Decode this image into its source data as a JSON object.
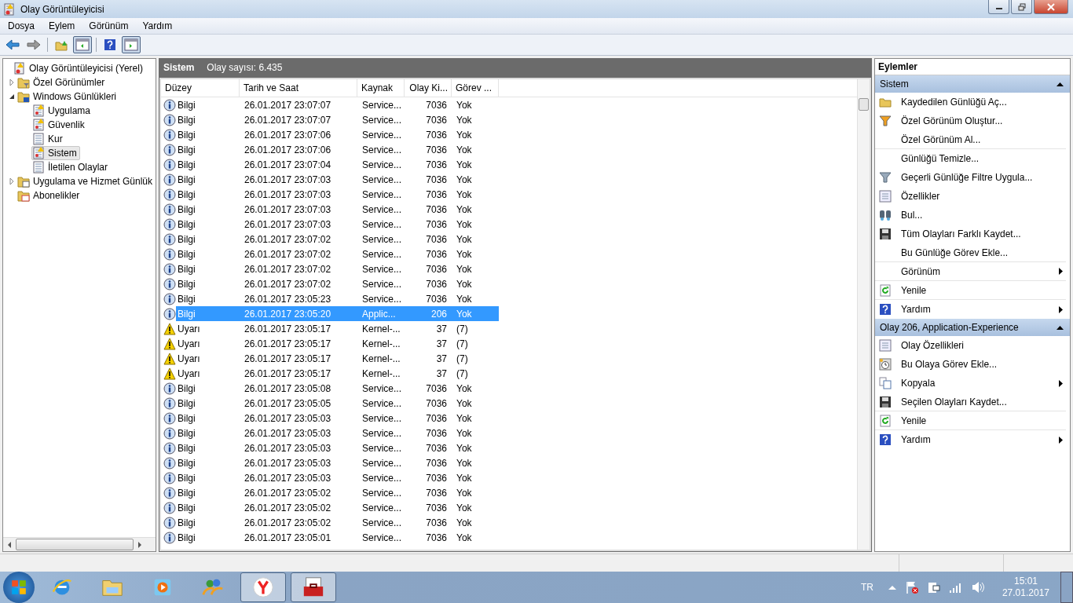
{
  "window": {
    "title": "Olay Görüntüleyicisi"
  },
  "menu": [
    "Dosya",
    "Eylem",
    "Görünüm",
    "Yardım"
  ],
  "toolbar": [
    {
      "kind": "back",
      "pressed": false
    },
    {
      "kind": "forward",
      "pressed": false
    },
    {
      "kind": "sep"
    },
    {
      "kind": "up",
      "pressed": false
    },
    {
      "kind": "tree",
      "pressed": true
    },
    {
      "kind": "sep"
    },
    {
      "kind": "help",
      "pressed": false
    },
    {
      "kind": "pane",
      "pressed": true
    }
  ],
  "tree": [
    {
      "label": "Olay Görüntüleyicisi (Yerel)",
      "kind": "root",
      "selected": false,
      "children": [
        {
          "label": "Özel Görünümler",
          "kind": "folder-filter",
          "selected": false,
          "expanded": false
        },
        {
          "label": "Windows Günlükleri",
          "kind": "folder-windows",
          "selected": false,
          "expanded": true,
          "children": [
            {
              "label": "Uygulama",
              "kind": "log-alert",
              "selected": false
            },
            {
              "label": "Güvenlik",
              "kind": "log-alert",
              "selected": false
            },
            {
              "label": "Kur",
              "kind": "log",
              "selected": false
            },
            {
              "label": "Sistem",
              "kind": "log-alert",
              "selected": true
            },
            {
              "label": "İletilen Olaylar",
              "kind": "log",
              "selected": false
            }
          ]
        },
        {
          "label": "Uygulama ve Hizmet Günlük",
          "kind": "folder-app",
          "selected": false,
          "expanded": false
        },
        {
          "label": "Abonelikler",
          "kind": "folder-subs",
          "selected": false
        }
      ]
    }
  ],
  "log": {
    "title": "Sistem",
    "count": "Olay sayısı: 6.435"
  },
  "table": {
    "columns": [
      "Düzey",
      "Tarih ve Saat",
      "Kaynak",
      "Olay Ki...",
      "Görev ..."
    ],
    "rows": [
      {
        "kind": "info",
        "level_text": "Bilgi",
        "date": "26.01.2017 23:07:07",
        "source": "Service...",
        "id": "7036",
        "task": "Yok",
        "selected": false
      },
      {
        "kind": "info",
        "level_text": "Bilgi",
        "date": "26.01.2017 23:07:07",
        "source": "Service...",
        "id": "7036",
        "task": "Yok",
        "selected": false
      },
      {
        "kind": "info",
        "level_text": "Bilgi",
        "date": "26.01.2017 23:07:06",
        "source": "Service...",
        "id": "7036",
        "task": "Yok",
        "selected": false
      },
      {
        "kind": "info",
        "level_text": "Bilgi",
        "date": "26.01.2017 23:07:06",
        "source": "Service...",
        "id": "7036",
        "task": "Yok",
        "selected": false
      },
      {
        "kind": "info",
        "level_text": "Bilgi",
        "date": "26.01.2017 23:07:04",
        "source": "Service...",
        "id": "7036",
        "task": "Yok",
        "selected": false
      },
      {
        "kind": "info",
        "level_text": "Bilgi",
        "date": "26.01.2017 23:07:03",
        "source": "Service...",
        "id": "7036",
        "task": "Yok",
        "selected": false
      },
      {
        "kind": "info",
        "level_text": "Bilgi",
        "date": "26.01.2017 23:07:03",
        "source": "Service...",
        "id": "7036",
        "task": "Yok",
        "selected": false
      },
      {
        "kind": "info",
        "level_text": "Bilgi",
        "date": "26.01.2017 23:07:03",
        "source": "Service...",
        "id": "7036",
        "task": "Yok",
        "selected": false
      },
      {
        "kind": "info",
        "level_text": "Bilgi",
        "date": "26.01.2017 23:07:03",
        "source": "Service...",
        "id": "7036",
        "task": "Yok",
        "selected": false
      },
      {
        "kind": "info",
        "level_text": "Bilgi",
        "date": "26.01.2017 23:07:02",
        "source": "Service...",
        "id": "7036",
        "task": "Yok",
        "selected": false
      },
      {
        "kind": "info",
        "level_text": "Bilgi",
        "date": "26.01.2017 23:07:02",
        "source": "Service...",
        "id": "7036",
        "task": "Yok",
        "selected": false
      },
      {
        "kind": "info",
        "level_text": "Bilgi",
        "date": "26.01.2017 23:07:02",
        "source": "Service...",
        "id": "7036",
        "task": "Yok",
        "selected": false
      },
      {
        "kind": "info",
        "level_text": "Bilgi",
        "date": "26.01.2017 23:07:02",
        "source": "Service...",
        "id": "7036",
        "task": "Yok",
        "selected": false
      },
      {
        "kind": "info",
        "level_text": "Bilgi",
        "date": "26.01.2017 23:05:23",
        "source": "Service...",
        "id": "7036",
        "task": "Yok",
        "selected": false
      },
      {
        "kind": "info",
        "level_text": "Bilgi",
        "date": "26.01.2017 23:05:20",
        "source": "Applic...",
        "id": "206",
        "task": "Yok",
        "selected": true
      },
      {
        "kind": "warning",
        "level_text": "Uyarı",
        "date": "26.01.2017 23:05:17",
        "source": "Kernel-...",
        "id": "37",
        "task": "(7)",
        "selected": false
      },
      {
        "kind": "warning",
        "level_text": "Uyarı",
        "date": "26.01.2017 23:05:17",
        "source": "Kernel-...",
        "id": "37",
        "task": "(7)",
        "selected": false
      },
      {
        "kind": "warning",
        "level_text": "Uyarı",
        "date": "26.01.2017 23:05:17",
        "source": "Kernel-...",
        "id": "37",
        "task": "(7)",
        "selected": false
      },
      {
        "kind": "warning",
        "level_text": "Uyarı",
        "date": "26.01.2017 23:05:17",
        "source": "Kernel-...",
        "id": "37",
        "task": "(7)",
        "selected": false
      },
      {
        "kind": "info",
        "level_text": "Bilgi",
        "date": "26.01.2017 23:05:08",
        "source": "Service...",
        "id": "7036",
        "task": "Yok",
        "selected": false
      },
      {
        "kind": "info",
        "level_text": "Bilgi",
        "date": "26.01.2017 23:05:05",
        "source": "Service...",
        "id": "7036",
        "task": "Yok",
        "selected": false
      },
      {
        "kind": "info",
        "level_text": "Bilgi",
        "date": "26.01.2017 23:05:03",
        "source": "Service...",
        "id": "7036",
        "task": "Yok",
        "selected": false
      },
      {
        "kind": "info",
        "level_text": "Bilgi",
        "date": "26.01.2017 23:05:03",
        "source": "Service...",
        "id": "7036",
        "task": "Yok",
        "selected": false
      },
      {
        "kind": "info",
        "level_text": "Bilgi",
        "date": "26.01.2017 23:05:03",
        "source": "Service...",
        "id": "7036",
        "task": "Yok",
        "selected": false
      },
      {
        "kind": "info",
        "level_text": "Bilgi",
        "date": "26.01.2017 23:05:03",
        "source": "Service...",
        "id": "7036",
        "task": "Yok",
        "selected": false
      },
      {
        "kind": "info",
        "level_text": "Bilgi",
        "date": "26.01.2017 23:05:03",
        "source": "Service...",
        "id": "7036",
        "task": "Yok",
        "selected": false
      },
      {
        "kind": "info",
        "level_text": "Bilgi",
        "date": "26.01.2017 23:05:02",
        "source": "Service...",
        "id": "7036",
        "task": "Yok",
        "selected": false
      },
      {
        "kind": "info",
        "level_text": "Bilgi",
        "date": "26.01.2017 23:05:02",
        "source": "Service...",
        "id": "7036",
        "task": "Yok",
        "selected": false
      },
      {
        "kind": "info",
        "level_text": "Bilgi",
        "date": "26.01.2017 23:05:02",
        "source": "Service...",
        "id": "7036",
        "task": "Yok",
        "selected": false
      },
      {
        "kind": "info",
        "level_text": "Bilgi",
        "date": "26.01.2017 23:05:01",
        "source": "Service...",
        "id": "7036",
        "task": "Yok",
        "selected": false
      }
    ]
  },
  "actions": {
    "title": "Eylemler",
    "sections": [
      {
        "title": "Sistem",
        "items": [
          {
            "label": "Kaydedilen Günlüğü Aç...",
            "kind": "folder",
            "submenu": false,
            "separator": false
          },
          {
            "label": "Özel Görünüm Oluştur...",
            "kind": "filter",
            "submenu": false,
            "separator": false
          },
          {
            "label": "Özel Görünüm Al...",
            "kind": "plain",
            "submenu": false,
            "separator": true
          },
          {
            "label": "Günlüğü Temizle...",
            "kind": "plain",
            "submenu": false,
            "separator": false
          },
          {
            "label": "Geçerli Günlüğe Filtre Uygula...",
            "kind": "filtergrey",
            "submenu": false,
            "separator": false
          },
          {
            "label": "Özellikler",
            "kind": "properties",
            "submenu": false,
            "separator": false
          },
          {
            "label": "Bul...",
            "kind": "find",
            "submenu": false,
            "separator": false
          },
          {
            "label": "Tüm Olayları Farklı Kaydet...",
            "kind": "save",
            "submenu": false,
            "separator": false
          },
          {
            "label": "Bu Günlüğe Görev Ekle...",
            "kind": "plain",
            "submenu": false,
            "separator": true
          },
          {
            "label": "Görünüm",
            "kind": "plain",
            "submenu": true,
            "separator": true
          },
          {
            "label": "Yenile",
            "kind": "refresh",
            "submenu": false,
            "separator": true
          },
          {
            "label": "Yardım",
            "kind": "help",
            "submenu": true,
            "separator": false
          }
        ]
      },
      {
        "title": "Olay 206, Application-Experience",
        "items": [
          {
            "label": "Olay Özellikleri",
            "kind": "properties",
            "submenu": false,
            "separator": false
          },
          {
            "label": "Bu Olaya Görev Ekle...",
            "kind": "task",
            "submenu": false,
            "separator": false
          },
          {
            "label": "Kopyala",
            "kind": "copy",
            "submenu": true,
            "separator": false
          },
          {
            "label": "Seçilen Olayları Kaydet...",
            "kind": "save",
            "submenu": false,
            "separator": true
          },
          {
            "label": "Yenile",
            "kind": "refresh",
            "submenu": false,
            "separator": true
          },
          {
            "label": "Yardım",
            "kind": "help",
            "submenu": true,
            "separator": false
          }
        ]
      }
    ]
  },
  "taskbar": {
    "apps": [
      {
        "kind": "ie",
        "active": false
      },
      {
        "kind": "explorer",
        "active": false
      },
      {
        "kind": "media",
        "active": false
      },
      {
        "kind": "messenger",
        "active": false
      },
      {
        "kind": "yandex",
        "active": true
      },
      {
        "kind": "toolbox",
        "active": true
      }
    ],
    "language": "TR",
    "time": "15:01",
    "date": "27.01.2017"
  }
}
